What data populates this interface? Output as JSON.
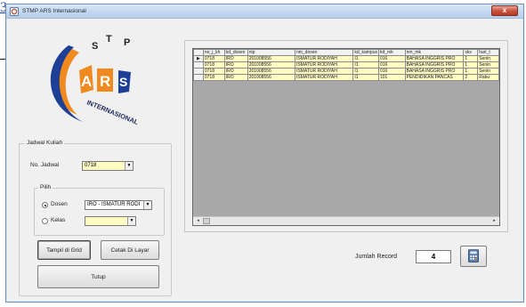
{
  "corner_link": "3",
  "window": {
    "title": "STMP ARS Internasional",
    "close_label": "x"
  },
  "logo": {
    "top_letters": [
      "S",
      "T",
      "P"
    ],
    "main_letters": [
      "A",
      "R",
      "S"
    ],
    "arc_text": "INTERNASIONAL"
  },
  "jadwal": {
    "group_label": "Jadwal Kuliah",
    "no_jadwal_label": "No. Jadwal",
    "no_jadwal_value": "0718",
    "pilih_label": "Pilih",
    "dosen_label": "Dosen",
    "dosen_value": "IRO - ISMATUR RODI",
    "kelas_label": "Kelas",
    "kelas_value": "",
    "selected_option": "Dosen"
  },
  "buttons": {
    "tampil": "Tampil di Grid",
    "cetak": "Cetak Di Layar",
    "tutup": "Tutup"
  },
  "grid": {
    "columns": [
      "no_j_kh",
      "kd_dosen",
      "nip",
      "nm_dosen",
      "kd_kampus",
      "kd_mk",
      "nm_mk",
      "sks",
      "hari_t"
    ],
    "rows": [
      [
        "0718",
        "IRO",
        "201008556",
        "ISMATUR RODIYAH",
        "I1",
        "016",
        "BAHASA INGGRIS PRO",
        "1",
        "Senin"
      ],
      [
        "0718",
        "IRO",
        "201008556",
        "ISMATUR RODIYAH",
        "I1",
        "016",
        "BAHASA INGGRIS PRO",
        "1",
        "Senin"
      ],
      [
        "0718",
        "IRO",
        "201008556",
        "ISMATUR RODIYAH",
        "I1",
        "016",
        "BAHASA INGGRIS PRO",
        "1",
        "Senin"
      ],
      [
        "0718",
        "IRO",
        "201008556",
        "ISMATUR RODIYAH",
        "I1",
        "101",
        "PENDIDIKAN PANCAS",
        "2",
        "Rabu"
      ]
    ],
    "current_row_marker": "▶",
    "scroll_left": "◂",
    "scroll_right": "▸"
  },
  "record": {
    "label": "Jumlah Record",
    "count": "4"
  },
  "colors": {
    "accent_orange": "#f08a1f",
    "accent_blue": "#1d3f95",
    "cell_yellow": "#fffbc2"
  }
}
